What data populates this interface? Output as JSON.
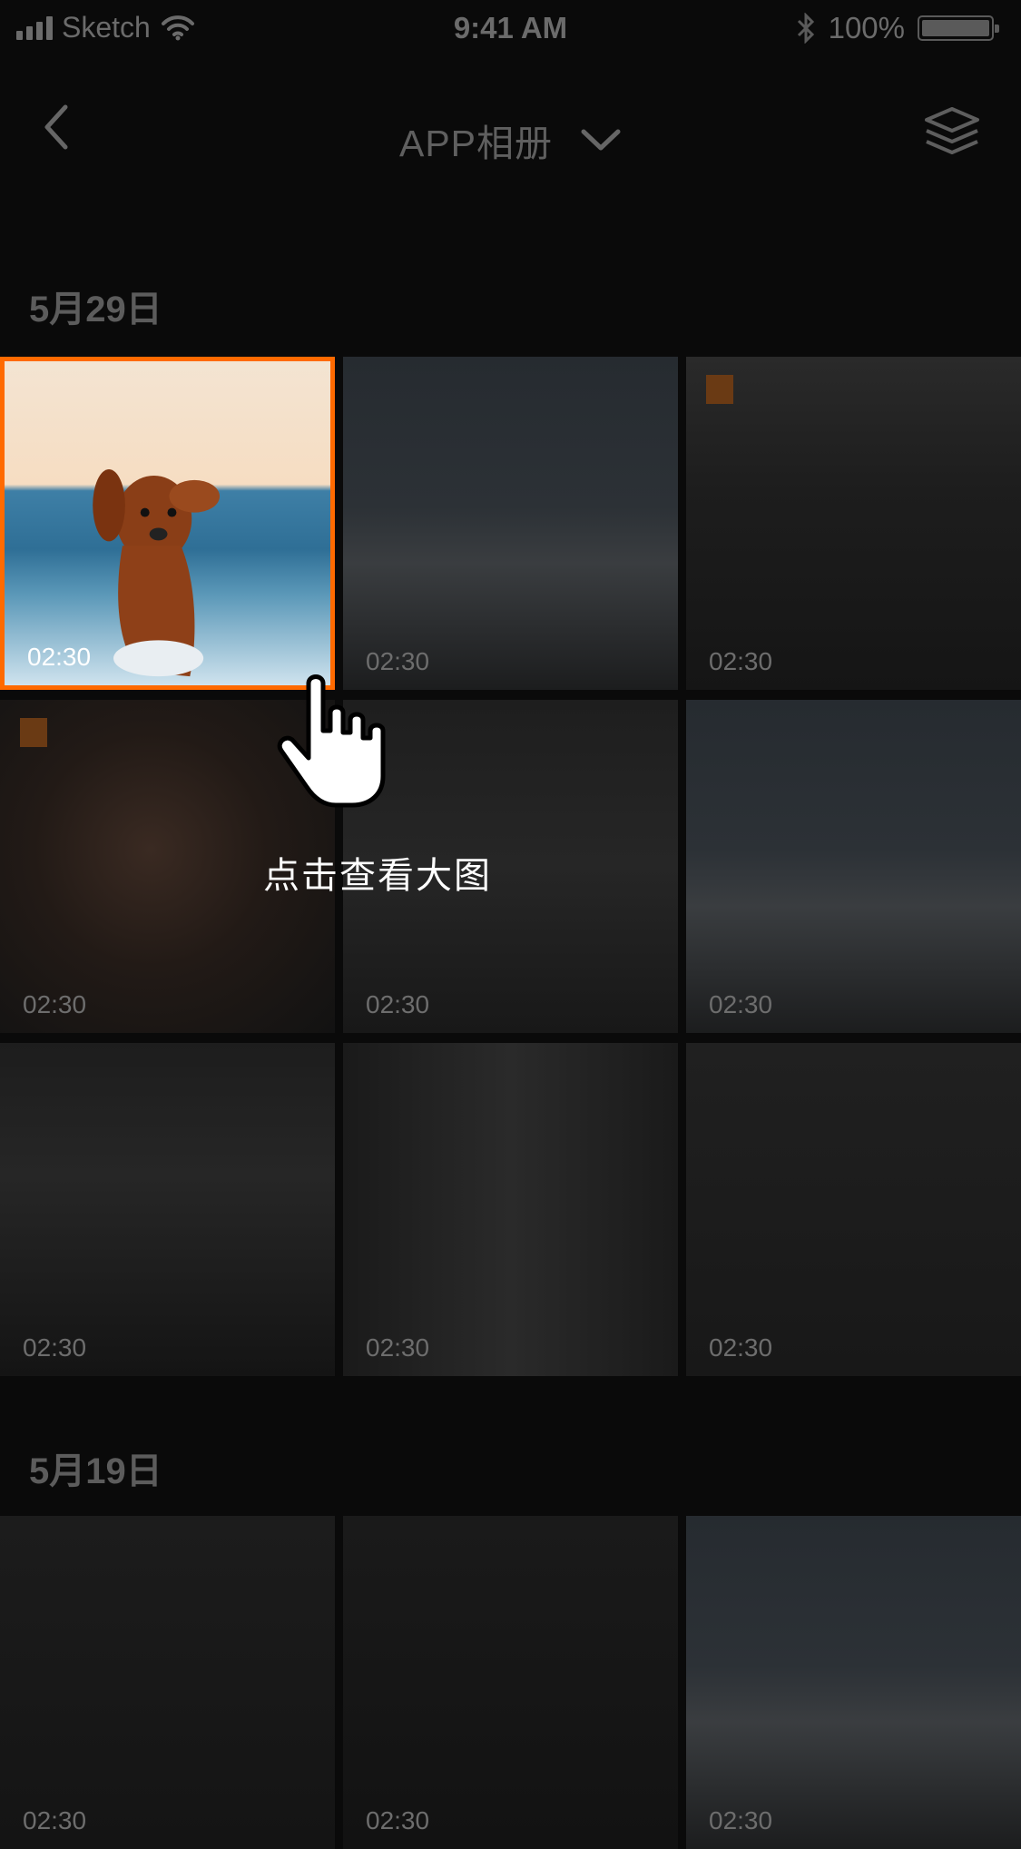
{
  "status_bar": {
    "carrier": "Sketch",
    "time": "9:41 AM",
    "battery_text": "100%"
  },
  "nav": {
    "title": "APP相册",
    "back_icon": "chevron-left-icon",
    "dropdown_icon": "chevron-down-icon",
    "layers_icon": "layers-icon"
  },
  "sections": [
    {
      "date": "5月29日",
      "items": [
        {
          "duration": "02:30",
          "selected": true,
          "scene": "dog-beach"
        },
        {
          "duration": "02:30",
          "scene": "bridge-mountain"
        },
        {
          "duration": "02:30",
          "scene": "figure-dark",
          "marked": true
        },
        {
          "duration": "02:30",
          "scene": "smiling-woman",
          "marked": true
        },
        {
          "duration": "02:30",
          "scene": "forest-bridge"
        },
        {
          "duration": "02:30",
          "scene": "bridge-mountain"
        },
        {
          "duration": "02:30",
          "scene": "rocky-mountain"
        },
        {
          "duration": "02:30",
          "scene": "tunnel-portrait"
        },
        {
          "duration": "02:30",
          "scene": "rock-cliff"
        }
      ]
    },
    {
      "date": "5月19日",
      "items": [
        {
          "duration": "02:30",
          "scene": "portrait-dark"
        },
        {
          "duration": "02:30",
          "scene": "night-road"
        },
        {
          "duration": "02:30",
          "scene": "bridge-mountain"
        }
      ]
    }
  ],
  "tooltip": {
    "text": "点击查看大图",
    "icon": "hand-pointer-icon"
  },
  "colors": {
    "accent": "#ff6a00",
    "background": "#0a0a0a"
  }
}
